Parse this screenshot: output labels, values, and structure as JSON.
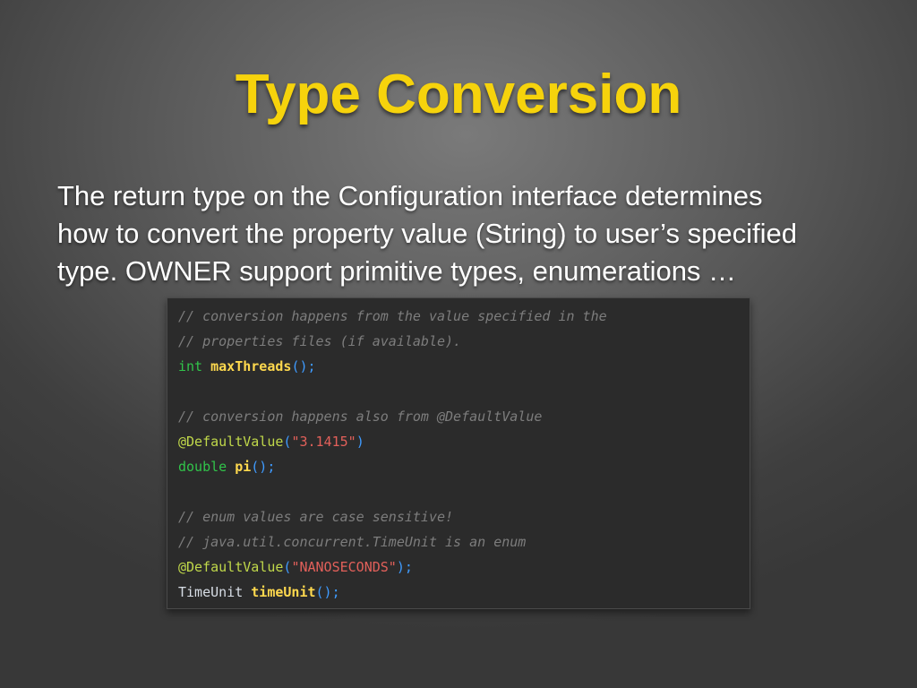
{
  "slide": {
    "title": "Type Conversion",
    "body_lines": [
      "The return type on the Configuration interface determines",
      "how to convert the property value (String) to user’s specified",
      "type. OWNER support primitive types, enumerations …"
    ]
  },
  "code": {
    "line1_comment": "// conversion happens from the value specified in the",
    "line2_comment": "// properties files (if available).",
    "line3_type": "int",
    "line3_method": "maxThreads",
    "line3_punct": "();",
    "line5_comment": "// conversion happens also from @DefaultValue",
    "line6_annotation": "@DefaultValue",
    "line6_open": "(",
    "line6_string": "\"3.1415\"",
    "line6_close": ")",
    "line7_type": "double",
    "line7_method": "pi",
    "line7_punct": "();",
    "line9_comment": "// enum values are case sensitive!",
    "line10_comment": "// java.util.concurrent.TimeUnit is an enum",
    "line11_annotation": "@DefaultValue",
    "line11_open": "(",
    "line11_string": "\"NANOSECONDS\"",
    "line11_close": ");",
    "line12_type": "TimeUnit",
    "line12_method": "timeUnit",
    "line12_punct": "();"
  },
  "colors": {
    "title": "#f6d30c",
    "body_text": "#ffffff",
    "code_background": "#2b2b2b",
    "comment": "#7d7d7d",
    "keyword": "#31c44a",
    "method": "#ffd94e",
    "annotation": "#c0d84a",
    "string": "#e2605a",
    "punctuation": "#3f9bff"
  }
}
